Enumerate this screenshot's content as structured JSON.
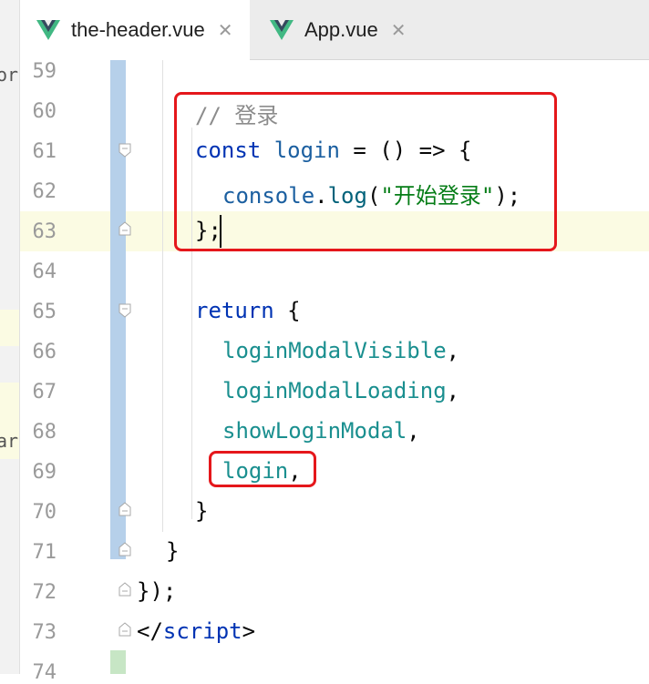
{
  "tabs": [
    {
      "label": "the-header.vue",
      "active": true,
      "icon": "vue-logo-icon"
    },
    {
      "label": "App.vue",
      "active": false,
      "icon": "vue-logo-icon"
    }
  ],
  "left_panel_fragments": [
    "or",
    "ar"
  ],
  "line_numbers": [
    "59",
    "60",
    "61",
    "62",
    "63",
    "64",
    "65",
    "66",
    "67",
    "68",
    "69",
    "70",
    "71",
    "72",
    "73",
    "74"
  ],
  "code": {
    "l60_comment": "// 登录",
    "l61_const": "const",
    "l61_name": "login",
    "l61_rest": " = () => {",
    "l62_obj": "console",
    "l62_dot": ".",
    "l62_fn": "log",
    "l62_open": "(",
    "l62_str": "\"开始登录\"",
    "l62_close": ");",
    "l63": "};",
    "l65_kw": "return",
    "l65_rest": " {",
    "l66": "loginModalVisible",
    "l67": "loginModalLoading",
    "l68": "showLoginModal",
    "l69": "login",
    "comma": ",",
    "l70": "}",
    "l71": "}",
    "l72": "});",
    "l73_open": "</",
    "l73_tag": "script",
    "l73_close": ">"
  },
  "colors": {
    "keyword": "#0033b3",
    "string": "#067d17",
    "property": "#1a8f8f",
    "highlight_box": "#e5171b"
  }
}
